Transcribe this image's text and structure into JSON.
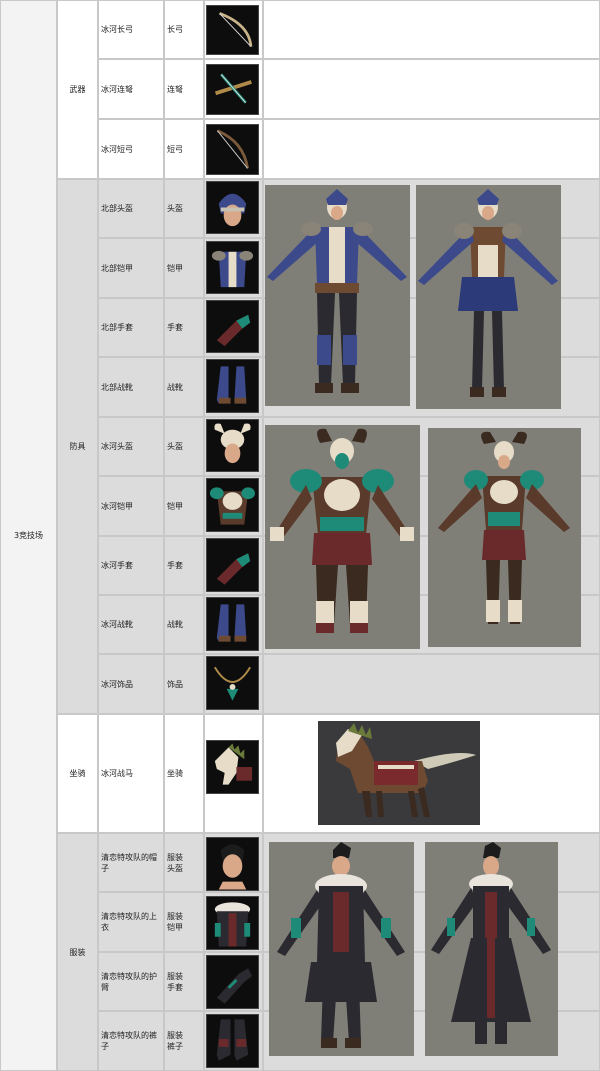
{
  "category": "3竞技场",
  "groups": [
    {
      "label": "武器",
      "items": [
        {
          "name": "冰河长弓",
          "type": "长弓",
          "icon": "longbow-icon"
        },
        {
          "name": "冰河连弩",
          "type": "连弩",
          "icon": "crossbow-icon"
        },
        {
          "name": "冰河短弓",
          "type": "短弓",
          "icon": "shortbow-icon"
        }
      ]
    },
    {
      "label": "防具",
      "items": [
        {
          "name": "北部头盔",
          "type": "头盔",
          "icon": "helmet-icon"
        },
        {
          "name": "北部铠甲",
          "type": "铠甲",
          "icon": "armor-icon"
        },
        {
          "name": "北部手套",
          "type": "手套",
          "icon": "glove-icon"
        },
        {
          "name": "北部战靴",
          "type": "战靴",
          "icon": "boots-icon"
        },
        {
          "name": "冰河头盔",
          "type": "头盔",
          "icon": "horned-helmet-icon"
        },
        {
          "name": "冰河铠甲",
          "type": "铠甲",
          "icon": "skull-armor-icon"
        },
        {
          "name": "冰河手套",
          "type": "手套",
          "icon": "glove-icon"
        },
        {
          "name": "冰河战靴",
          "type": "战靴",
          "icon": "boots-icon"
        },
        {
          "name": "冰河饰品",
          "type": "饰品",
          "icon": "necklace-icon"
        }
      ]
    },
    {
      "label": "坐骑",
      "items": [
        {
          "name": "冰河战马",
          "type": "坐骑",
          "icon": "war-horse-icon"
        }
      ]
    },
    {
      "label": "服装",
      "items": [
        {
          "name": "清恋特攻队的帽子",
          "type": "服装\n头盔",
          "icon": "hair-head-icon"
        },
        {
          "name": "清恋特攻队的上衣",
          "type": "服装\n铠甲",
          "icon": "fur-coat-icon"
        },
        {
          "name": "清恋特攻队的护臂",
          "type": "服装\n手套",
          "icon": "bracer-icon"
        },
        {
          "name": "清恋特攻队的裤子",
          "type": "服装\n裤子",
          "icon": "pants-icon"
        }
      ]
    }
  ],
  "colors": {
    "navy": "#3c4a8c",
    "teal": "#1e8a78",
    "bone": "#e6dcc8",
    "leather": "#6e4a32",
    "dark": "#2a2a30",
    "crimson": "#6a2a2c",
    "model_bg": "#8a8a80"
  }
}
